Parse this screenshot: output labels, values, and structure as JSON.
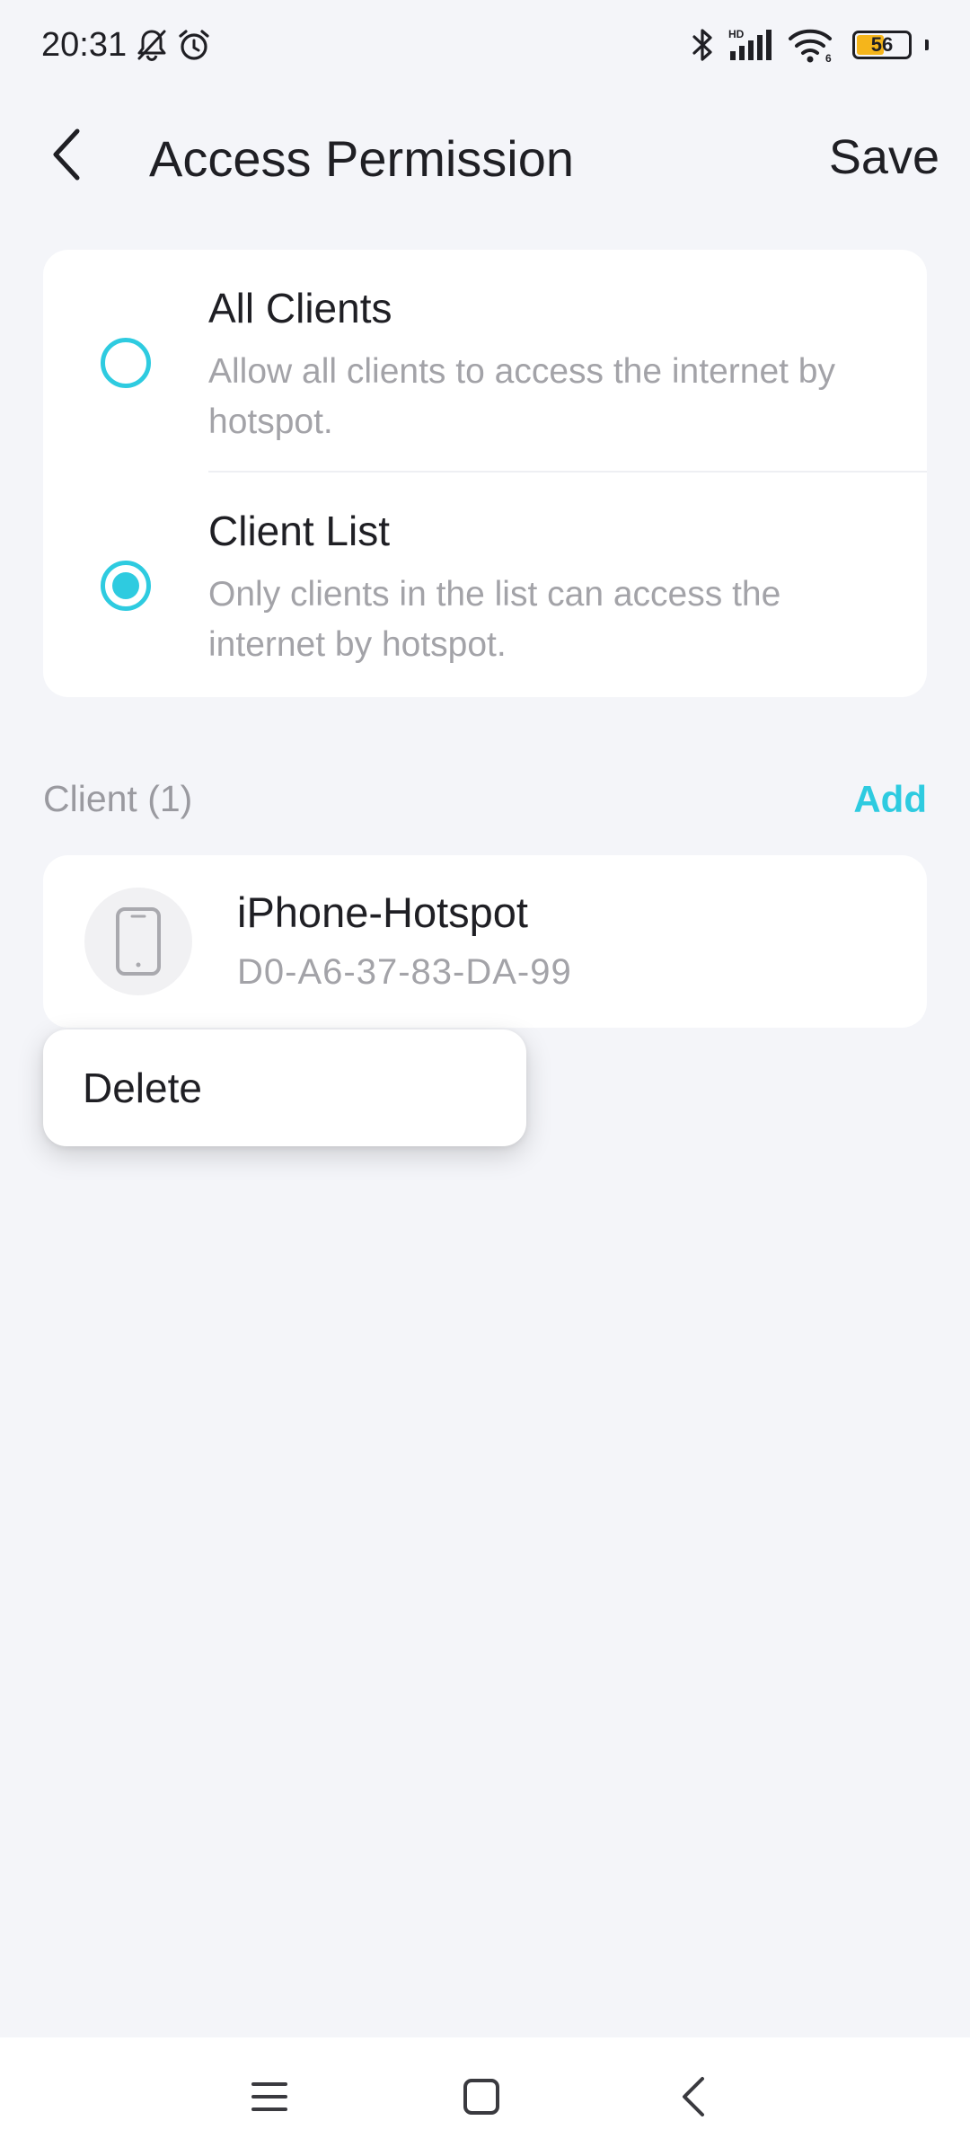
{
  "status_bar": {
    "time": "20:31",
    "icons": [
      "bell-off-icon",
      "alarm-icon",
      "bluetooth-icon",
      "signal-icon",
      "wifi-icon"
    ],
    "signal_badge": "HD",
    "wifi_badge": "6",
    "battery_level": "56",
    "battery_fraction": 0.56,
    "battery_color": "#f5b51b"
  },
  "header": {
    "title": "Access Permission",
    "save_label": "Save"
  },
  "options": [
    {
      "title": "All Clients",
      "description": "Allow all clients to access the internet by hotspot.",
      "selected": false
    },
    {
      "title": "Client List",
      "description": "Only clients in the list can access the internet by hotspot.",
      "selected": true
    }
  ],
  "clients_section": {
    "title": "Client (1)",
    "add_label": "Add"
  },
  "clients": [
    {
      "name": "iPhone-Hotspot",
      "mac": "D0-A6-37-83-DA-99",
      "icon": "phone-icon"
    }
  ],
  "context_menu": {
    "delete_label": "Delete"
  },
  "nav_bar": {
    "icons": [
      "menu-icon",
      "home-icon",
      "back-icon"
    ]
  },
  "colors": {
    "accent": "#2ecbe0",
    "background": "#f4f5f9",
    "card": "#ffffff",
    "secondary_text": "#a3a3a8"
  }
}
